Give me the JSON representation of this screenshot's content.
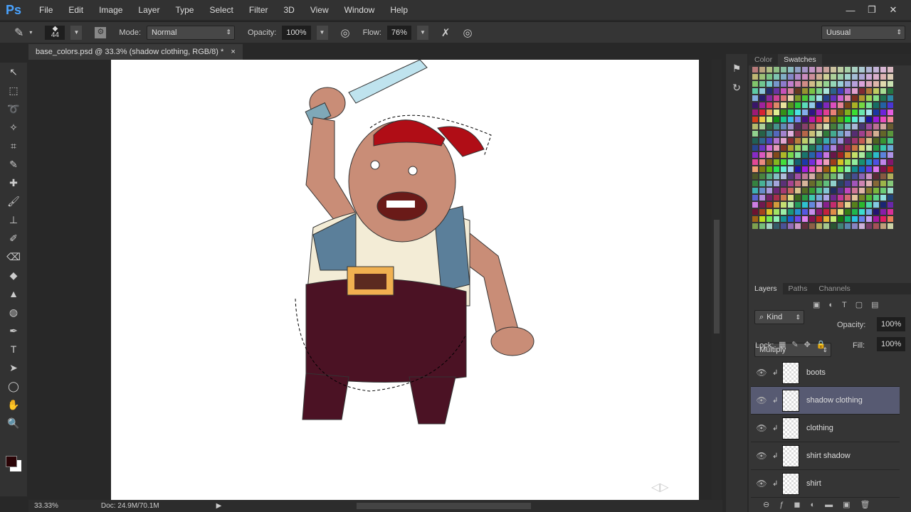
{
  "app": {
    "logo": "Ps",
    "menus": [
      "File",
      "Edit",
      "Image",
      "Layer",
      "Type",
      "Select",
      "Filter",
      "3D",
      "View",
      "Window",
      "Help"
    ],
    "window_controls": [
      "—",
      "❐",
      "✕"
    ]
  },
  "options": {
    "brush_size": "44",
    "mode_label": "Mode:",
    "mode_value": "Normal",
    "opacity_label": "Opacity:",
    "opacity_value": "100%",
    "flow_label": "Flow:",
    "flow_value": "76%",
    "workspace": "Uusual"
  },
  "document": {
    "tab_title": "base_colors.psd @ 33.3% (shadow clothing, RGB/8) *",
    "close": "×"
  },
  "status": {
    "zoom": "33.33%",
    "doc_info": "Doc: 24.9M/70.1M"
  },
  "tools": [
    "↖",
    "⬚",
    "➰",
    "✧",
    "⌗",
    "✎",
    "✚",
    "🖌",
    "⊥",
    "✐",
    "⌫",
    "◆",
    "▲",
    "◍",
    "✒",
    "T",
    "➤",
    "◯",
    "✋",
    "🔍"
  ],
  "panels": {
    "top_tabs": [
      "Color",
      "Swatches"
    ],
    "layers_tabs": [
      "Layers",
      "Paths",
      "Channels"
    ],
    "filter_kind": "Kind",
    "blend_mode": "Multiply",
    "opacity_label": "Opacity:",
    "opacity_value": "100%",
    "lock_label": "Lock:",
    "fill_label": "Fill:",
    "fill_value": "100%",
    "layers": [
      {
        "name": "boots",
        "selected": false
      },
      {
        "name": "shadow clothing",
        "selected": true
      },
      {
        "name": "clothing",
        "selected": false
      },
      {
        "name": "shirt shadow",
        "selected": false
      },
      {
        "name": "shirt",
        "selected": false
      }
    ]
  }
}
